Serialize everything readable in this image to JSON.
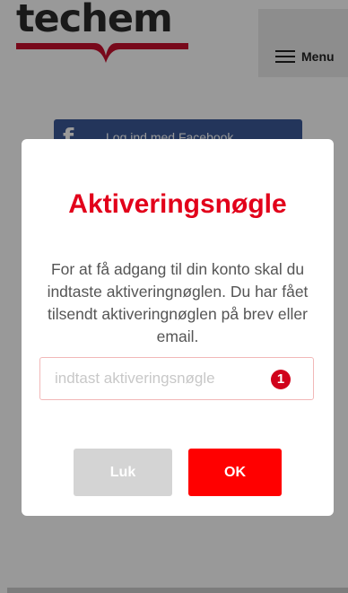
{
  "header": {
    "logo_text": "techem",
    "logo_icon": "techem-logo",
    "menu_icon": "hamburger-icon",
    "menu_label": "Menu"
  },
  "login": {
    "facebook_icon": "facebook-icon",
    "facebook_label": "Log ind med Facebook"
  },
  "dialog": {
    "title": "Aktiveringsnøgle",
    "message": "For at få adgang til din konto skal du indtaste aktiveringnøglen. Du har fået tilsendt aktiveringnøglen på brev eller email.",
    "input_value": "",
    "input_placeholder": "indtast aktiveringsnøgle",
    "error_badge": "1",
    "close_label": "Luk",
    "ok_label": "OK"
  },
  "colors": {
    "brand_red": "#e2001a",
    "ok_button": "#ff0000",
    "close_button": "#d4d4d4",
    "facebook_blue": "#3b5998",
    "overlay": "rgba(0,0,0,0.40)"
  }
}
